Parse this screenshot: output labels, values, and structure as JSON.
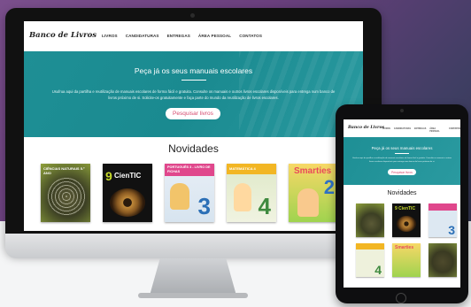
{
  "site": {
    "brand": "Banco de Livros",
    "nav": [
      "LIVROS",
      "CANDIDATURAS",
      "ENTREGAS",
      "ÁREA PESSOAL",
      "CONTATOS"
    ],
    "hero": {
      "title": "Peça já os seus manuais escolares",
      "text": "Usufrua aqui da partilha e reutilização de manuais escolares de forma fácil e gratuita. Consulte os manuais e outros livros escolares disponíveis para entrega num banco de livros próximo de si. Solicite-os gratuitamente e faça parte do mundo da reutilização de livros escolares.",
      "button": "Pesquisar livros"
    },
    "section_title": "Novidades",
    "books": [
      {
        "title": "CIÊNCIAS NATURAIS 5.º ANO"
      },
      {
        "title": "CienTIC",
        "number": "9"
      },
      {
        "title": "PORTUGUÊS 3 - LIVRO DE FICHAS",
        "number": "3"
      },
      {
        "title": "MATEMÁTICA 4",
        "number": "4"
      },
      {
        "title": "Smarties",
        "number": "2"
      }
    ]
  },
  "colors": {
    "hero": "#1e8f95",
    "button_text": "#d64a6e"
  },
  "tablet": {
    "brand": "Banco de Livros",
    "nav": [
      "LIVROS",
      "CANDIDATURAS",
      "ENTREGAS",
      "ÁREA PESSOAL",
      "CONTATOS"
    ],
    "hero_title": "Peça já os seus manuais escolares",
    "hero_text": "Usufrua aqui da partilha e reutilização de manuais escolares de forma fácil e gratuita. Consulte os manuais e outros livros escolares disponíveis para entrega num banco de livros próximo de si.",
    "button": "Pesquisar livros",
    "section_title": "Novidades",
    "book_labels": [
      "",
      "9 CienTIC",
      "3",
      "4",
      "Smarties",
      ""
    ]
  }
}
